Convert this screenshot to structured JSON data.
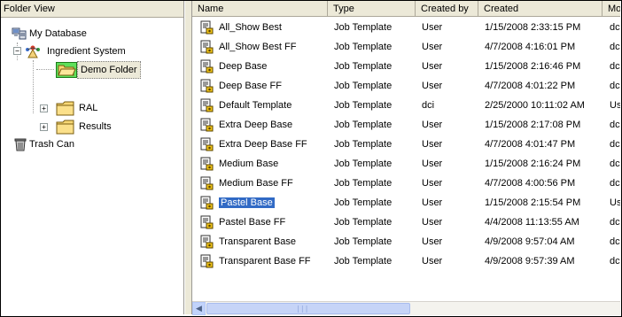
{
  "folder_view": {
    "header": "Folder View",
    "tree": [
      {
        "label": "My Database",
        "icon": "database-icon",
        "expander": ""
      },
      {
        "label": "Ingredient System",
        "icon": "ingredient-system-icon",
        "expander": "−"
      },
      {
        "label": "Demo Folder",
        "icon": "open-folder-icon",
        "expander": "",
        "selected": true
      },
      {
        "label": "RAL",
        "icon": "folder-icon",
        "expander": "+"
      },
      {
        "label": "Results",
        "icon": "folder-icon",
        "expander": "+"
      },
      {
        "label": "Trash Can",
        "icon": "trash-can-icon",
        "expander": ""
      }
    ]
  },
  "list": {
    "columns": [
      "Name",
      "Type",
      "Created by",
      "Created",
      "Mo"
    ],
    "rows": [
      {
        "name": "All_Show Best",
        "type": "Job Template",
        "created_by": "User",
        "created": "1/15/2008 2:33:15 PM",
        "modified": "dc"
      },
      {
        "name": "All_Show Best FF",
        "type": "Job Template",
        "created_by": "User",
        "created": "4/7/2008 4:16:01 PM",
        "modified": "dc"
      },
      {
        "name": "Deep Base",
        "type": "Job Template",
        "created_by": "User",
        "created": "1/15/2008 2:16:46 PM",
        "modified": "dc"
      },
      {
        "name": "Deep Base FF",
        "type": "Job Template",
        "created_by": "User",
        "created": "4/7/2008 4:01:22 PM",
        "modified": "dc"
      },
      {
        "name": "Default Template",
        "type": "Job Template",
        "created_by": "dci",
        "created": "2/25/2000 10:11:02 AM",
        "modified": "Us"
      },
      {
        "name": "Extra Deep Base",
        "type": "Job Template",
        "created_by": "User",
        "created": "1/15/2008 2:17:08 PM",
        "modified": "dc"
      },
      {
        "name": "Extra Deep Base FF",
        "type": "Job Template",
        "created_by": "User",
        "created": "4/7/2008 4:01:47 PM",
        "modified": "dc"
      },
      {
        "name": "Medium Base",
        "type": "Job Template",
        "created_by": "User",
        "created": "1/15/2008 2:16:24 PM",
        "modified": "dc"
      },
      {
        "name": "Medium Base FF",
        "type": "Job Template",
        "created_by": "User",
        "created": "4/7/2008 4:00:56 PM",
        "modified": "dc"
      },
      {
        "name": "Pastel Base",
        "type": "Job Template",
        "created_by": "User",
        "created": "1/15/2008 2:15:54 PM",
        "modified": "Us",
        "selected": true
      },
      {
        "name": "Pastel Base FF",
        "type": "Job Template",
        "created_by": "User",
        "created": "4/4/2008 11:13:55 AM",
        "modified": "dc"
      },
      {
        "name": "Transparent Base",
        "type": "Job Template",
        "created_by": "User",
        "created": "4/9/2008 9:57:04 AM",
        "modified": "dc"
      },
      {
        "name": "Transparent Base FF",
        "type": "Job Template",
        "created_by": "User",
        "created": "4/9/2008 9:57:39 AM",
        "modified": "dc"
      }
    ],
    "row_icon": "job-template-icon"
  },
  "colors": {
    "selection": "#316ac5",
    "header_bg": "#ece9d8",
    "folder_yellow": "#f7d774"
  }
}
